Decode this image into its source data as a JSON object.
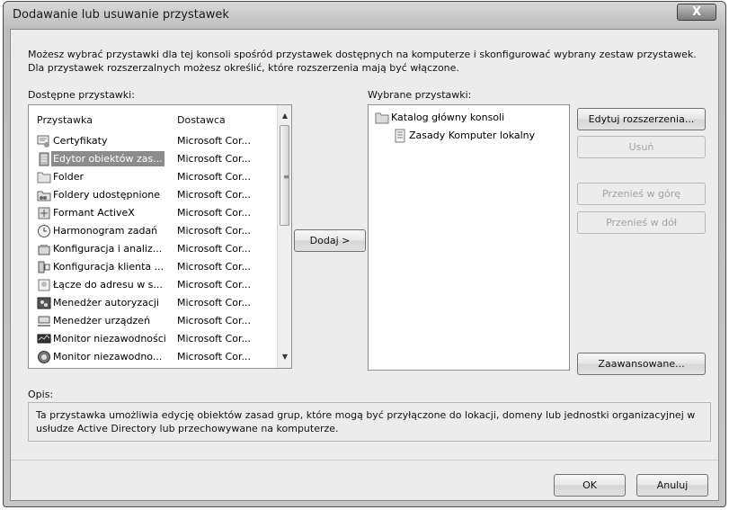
{
  "window": {
    "title": "Dodawanie lub usuwanie przystawek",
    "close_glyph": "X"
  },
  "intro": "Możesz wybrać przystawki dla tej konsoli spośród przystawek dostępnych na komputerze i skonfigurować wybrany zestaw przystawek. Dla przystawek rozszerzalnych możesz określić, które rozszerzenia mają być włączone.",
  "available": {
    "label": "Dostępne przystawki:",
    "columns": {
      "name": "Przystawka",
      "vendor": "Dostawca"
    },
    "rows": [
      {
        "name": "Certyfikaty",
        "vendor": "Microsoft Cor...",
        "icon": "certificate-icon",
        "selected": false
      },
      {
        "name": "Edytor obiektów zas...",
        "vendor": "Microsoft Cor...",
        "icon": "policy-editor-icon",
        "selected": true
      },
      {
        "name": "Folder",
        "vendor": "Microsoft Cor...",
        "icon": "folder-icon",
        "selected": false
      },
      {
        "name": "Foldery udostępnione",
        "vendor": "Microsoft Cor...",
        "icon": "shared-folders-icon",
        "selected": false
      },
      {
        "name": "Formant ActiveX",
        "vendor": "Microsoft Cor...",
        "icon": "activex-icon",
        "selected": false
      },
      {
        "name": "Harmonogram zadań",
        "vendor": "Microsoft Cor...",
        "icon": "clock-icon",
        "selected": false
      },
      {
        "name": "Konfiguracja i analiz...",
        "vendor": "Microsoft Cor...",
        "icon": "security-config-icon",
        "selected": false
      },
      {
        "name": "Konfiguracja klienta ...",
        "vendor": "Microsoft Cor...",
        "icon": "client-config-icon",
        "selected": false
      },
      {
        "name": "Łącze do adresu w s...",
        "vendor": "Microsoft Cor...",
        "icon": "web-link-icon",
        "selected": false
      },
      {
        "name": "Menedżer autoryzacji",
        "vendor": "Microsoft Cor...",
        "icon": "authorization-icon",
        "selected": false
      },
      {
        "name": "Menedżer urządzeń",
        "vendor": "Microsoft Cor...",
        "icon": "device-manager-icon",
        "selected": false
      },
      {
        "name": "Monitor niezawodności",
        "vendor": "Microsoft Cor...",
        "icon": "monitor-icon",
        "selected": false
      },
      {
        "name": "Monitor niezawodno...",
        "vendor": "Microsoft Cor...",
        "icon": "performance-icon",
        "selected": false
      }
    ]
  },
  "add_button": "Dodaj >",
  "selected": {
    "label": "Wybrane przystawki:",
    "root": "Katalog główny konsoli",
    "child": "Zasady Komputer lokalny"
  },
  "buttons": {
    "edit_extensions": "Edytuj rozszerzenia...",
    "remove": "Usuń",
    "move_up": "Przenieś w górę",
    "move_down": "Przenieś w dół",
    "advanced": "Zaawansowane...",
    "ok": "OK",
    "cancel": "Anuluj"
  },
  "description": {
    "label": "Opis:",
    "text": "Ta przystawka umożliwia edycję obiektów zasad grup, które mogą być przyłączone do lokacji, domeny lub jednostki organizacyjnej w usłudze Active Directory lub przechowywane na komputerze."
  },
  "colors": {
    "selection": "#8c8c8c",
    "disabled_text": "#a2a2a2"
  }
}
